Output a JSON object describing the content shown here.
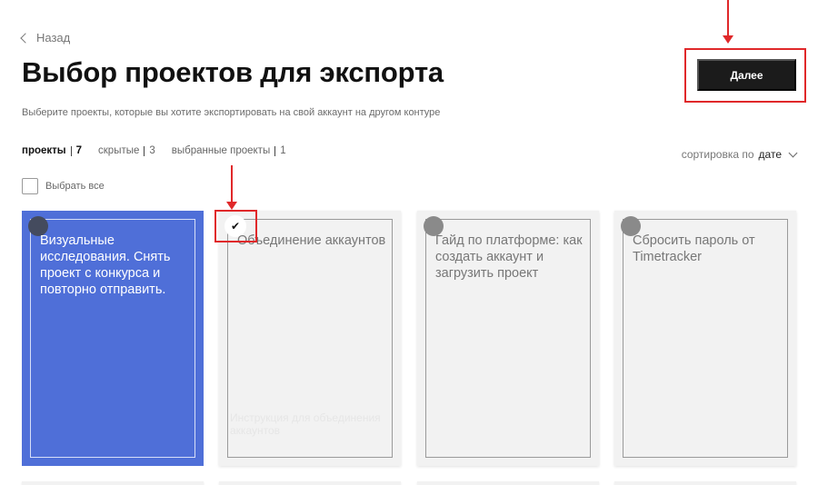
{
  "back": {
    "label": "Назад"
  },
  "title": "Выбор проектов для экспорта",
  "subtitle": "Выберите проекты, которые вы хотите экспортировать на свой аккаунт на другом контуре",
  "next_button": {
    "label": "Далее"
  },
  "tabs": [
    {
      "label": "проекты",
      "count": "7",
      "active": true
    },
    {
      "label": "скрытые",
      "count": "3",
      "active": false
    },
    {
      "label": "выбранные проекты",
      "count": "1",
      "active": false
    }
  ],
  "sort": {
    "prefix": "сортировка по",
    "value": "дате"
  },
  "select_all": {
    "label": "Выбрать все"
  },
  "cards": [
    {
      "title": "Визуальные исследования. Снять проект с конкурса и повторно отправить.",
      "selected": false
    },
    {
      "title": "Объединение аккаунтов",
      "selected": true,
      "footer_text": "Инструкция для объединения аккаунтов"
    },
    {
      "title": "Гайд по платформе: как создать аккаунт и загрузить проект",
      "selected": false
    },
    {
      "title": "Сбросить пароль от Timetracker",
      "selected": false
    }
  ],
  "colors": {
    "accent_blue": "#4f6fd8",
    "annotation_red": "#e0282a",
    "button_dark": "#1b1b1b"
  },
  "icons": {
    "check": "✔"
  }
}
